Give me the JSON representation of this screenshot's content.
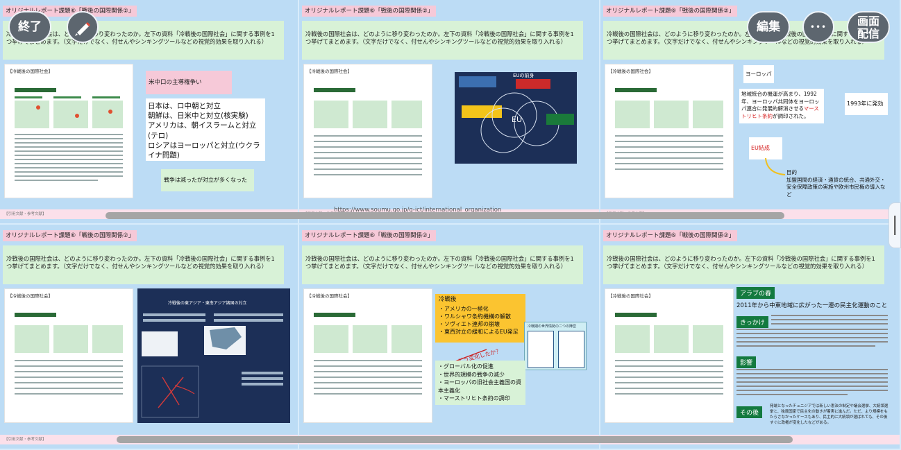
{
  "controls": {
    "end_label": "終了",
    "pen_icon": "pen-icon",
    "edit_label": "編集",
    "more_label": "•••",
    "screen_share_label": "画面\n配信"
  },
  "common": {
    "title": "オリジナルレポート課題⑥「戦後の国際関係②」",
    "prompt": "冷戦後の国際社会は、どのように移り変わったのか。左下の資料「冷戦後の国際社会」に関する事例を1つ挙げてまとめます。（文字だけでなく、付せんやシンキングツールなどの視覚的効果を取り入れる）",
    "doc_label": "【冷戦後の国際社会】",
    "footer": "【引用文献・参考文献】"
  },
  "slides": {
    "s1": {
      "topic": "米中口の主導権争い",
      "body": "日本は、ロ中朝と対立\n朝鮮は、日米中と対立(核実験)\nアメリカは、朝イスラームと対立(テロ)\nロシアはヨーロッパと対立(ウクライナ問題)",
      "conclusion": "戦争は減ったが対立が多くなった"
    },
    "s2": {
      "diagram_title": "EUの前身",
      "center_label": "EU",
      "url_cut": "https://www.soumu.go.jp/g-ict/international_organization"
    },
    "s3": {
      "region": "ヨーロッパ",
      "note_pre": "地域統合の機運が高まり、1992年、ヨーロッパ共同体をヨーロッパ連合に発展的解消させる",
      "note_red": "マーストリヒト条約",
      "note_post": "が調印された。",
      "effective": "1993年に発効",
      "eu_formation": "EU結成",
      "purpose_label": "目的",
      "purpose": "加盟国間の経済・通貨の統合、共通外交・安全保障政策の実施や欧州市民権の導入など"
    },
    "s4": {
      "map_title": "冷戦後の東アジア・東南アジア諸国の対立"
    },
    "s5": {
      "yellow_title": "冷戦後",
      "yellow_items": [
        "アメリカの一極化",
        "ワルシャワ条約機構の解散",
        "ソヴィエト連邦の崩壊",
        "東西対立の緩和によるEU発足"
      ],
      "question": "どう変化したか？",
      "diagram_title": "冷戦期の世界情勢の二つの陣営",
      "green_items": [
        "グローバル化の促進",
        "世界的規模の戦争の減少",
        "ヨーロッパの旧社会主義国の資本主義化",
        "マーストリヒト条約の調印"
      ]
    },
    "s6": {
      "tag1": "アラブの春",
      "desc1": "2011年から中東地域に広がった一連の民主化運動のこと",
      "tag2": "きっかけ",
      "tag3": "影響",
      "tag4": "その後",
      "after_text": "発端となったチュニジアでは新しい憲法の制定や議会選挙、大統領選挙と、独裁国家で民主化の動きが着実に進んだ。ただ、より規模をもたらさなかったケースもあり、民主的に大統領が選ばれても、その後すぐに政権が変化したなどがある。"
    }
  }
}
